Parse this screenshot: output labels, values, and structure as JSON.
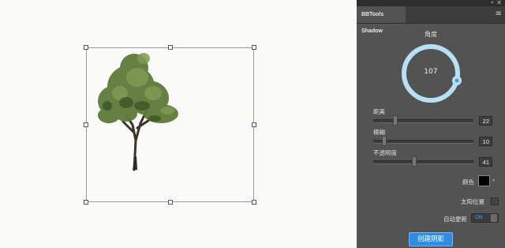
{
  "panel": {
    "title": "BBTools Shadow",
    "collapse_glyph": "»",
    "close_glyph": "✕",
    "menu_glyph": "≡"
  },
  "angle": {
    "label": "角度",
    "value": "107"
  },
  "sliders": [
    {
      "label": "距离",
      "value": "22",
      "level": 0.22
    },
    {
      "label": "模糊",
      "value": "10",
      "level": 0.1
    },
    {
      "label": "不透明度",
      "value": "41",
      "level": 0.41
    }
  ],
  "color": {
    "label": "颜色",
    "swatch_color": "#000000",
    "arrow_glyph": "▾"
  },
  "sun_position": {
    "label": "太阳位置",
    "checked": false
  },
  "auto_update": {
    "label": "自动更新",
    "toggle_text": "ON",
    "on": true
  },
  "create_button": {
    "label": "创建阴影"
  },
  "colors": {
    "accent": "#2f8ee3",
    "dial_ring": "#b8e0f4",
    "panel_bg": "#535353"
  },
  "icons": [
    "collapse-icon",
    "close-icon",
    "panel-menu-icon",
    "mouse-cursor-icon",
    "dial-handle-icon"
  ]
}
